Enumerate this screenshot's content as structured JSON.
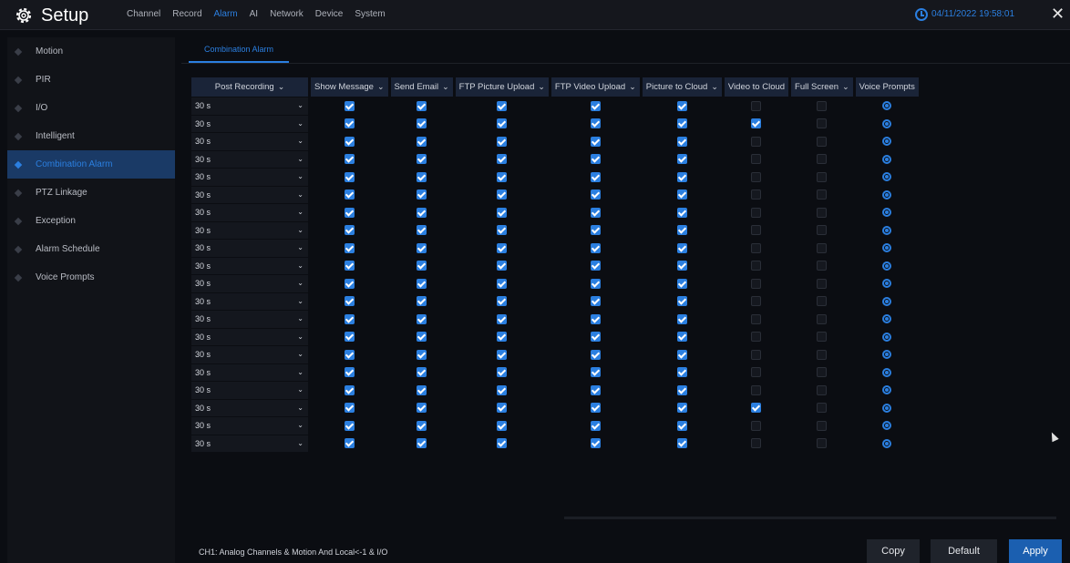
{
  "app": {
    "title": "Setup",
    "datetime": "04/11/2022 19:58:01",
    "nav": [
      "Channel",
      "Record",
      "Alarm",
      "AI",
      "Network",
      "Device",
      "System"
    ],
    "nav_active": "Alarm",
    "accent_color": "#2b7fe0"
  },
  "sidebar": {
    "items": [
      {
        "label": "Motion"
      },
      {
        "label": "PIR"
      },
      {
        "label": "I/O"
      },
      {
        "label": "Intelligent"
      },
      {
        "label": "Combination Alarm",
        "active": true
      },
      {
        "label": "PTZ Linkage"
      },
      {
        "label": "Exception"
      },
      {
        "label": "Alarm Schedule"
      },
      {
        "label": "Voice Prompts"
      }
    ]
  },
  "main": {
    "subtab": "Combination Alarm",
    "columns": [
      {
        "label": "Post Recording",
        "dropdown": true
      },
      {
        "label": "Show Message",
        "dropdown": true
      },
      {
        "label": "Send Email",
        "dropdown": true
      },
      {
        "label": "FTP Picture Upload",
        "dropdown": true
      },
      {
        "label": "FTP Video Upload",
        "dropdown": true
      },
      {
        "label": "Picture to Cloud",
        "dropdown": true
      },
      {
        "label": "Video to Cloud",
        "dropdown": false
      },
      {
        "label": "Full Screen",
        "dropdown": true
      },
      {
        "label": "Voice Prompts",
        "dropdown": false
      }
    ],
    "rows": [
      {
        "post": "30 s",
        "show": true,
        "email": true,
        "ftp_pic": true,
        "ftp_vid": true,
        "pic_cloud": true,
        "vid_cloud": false,
        "full": false
      },
      {
        "post": "30 s",
        "show": true,
        "email": true,
        "ftp_pic": true,
        "ftp_vid": true,
        "pic_cloud": true,
        "vid_cloud": true,
        "full": false
      },
      {
        "post": "30 s",
        "show": true,
        "email": true,
        "ftp_pic": true,
        "ftp_vid": true,
        "pic_cloud": true,
        "vid_cloud": false,
        "full": false
      },
      {
        "post": "30 s",
        "show": true,
        "email": true,
        "ftp_pic": true,
        "ftp_vid": true,
        "pic_cloud": true,
        "vid_cloud": false,
        "full": false
      },
      {
        "post": "30 s",
        "show": true,
        "email": true,
        "ftp_pic": true,
        "ftp_vid": true,
        "pic_cloud": true,
        "vid_cloud": false,
        "full": false
      },
      {
        "post": "30 s",
        "show": true,
        "email": true,
        "ftp_pic": true,
        "ftp_vid": true,
        "pic_cloud": true,
        "vid_cloud": false,
        "full": false
      },
      {
        "post": "30 s",
        "show": true,
        "email": true,
        "ftp_pic": true,
        "ftp_vid": true,
        "pic_cloud": true,
        "vid_cloud": false,
        "full": false
      },
      {
        "post": "30 s",
        "show": true,
        "email": true,
        "ftp_pic": true,
        "ftp_vid": true,
        "pic_cloud": true,
        "vid_cloud": false,
        "full": false
      },
      {
        "post": "30 s",
        "show": true,
        "email": true,
        "ftp_pic": true,
        "ftp_vid": true,
        "pic_cloud": true,
        "vid_cloud": false,
        "full": false
      },
      {
        "post": "30 s",
        "show": true,
        "email": true,
        "ftp_pic": true,
        "ftp_vid": true,
        "pic_cloud": true,
        "vid_cloud": false,
        "full": false
      },
      {
        "post": "30 s",
        "show": true,
        "email": true,
        "ftp_pic": true,
        "ftp_vid": true,
        "pic_cloud": true,
        "vid_cloud": false,
        "full": false
      },
      {
        "post": "30 s",
        "show": true,
        "email": true,
        "ftp_pic": true,
        "ftp_vid": true,
        "pic_cloud": true,
        "vid_cloud": false,
        "full": false
      },
      {
        "post": "30 s",
        "show": true,
        "email": true,
        "ftp_pic": true,
        "ftp_vid": true,
        "pic_cloud": true,
        "vid_cloud": false,
        "full": false
      },
      {
        "post": "30 s",
        "show": true,
        "email": true,
        "ftp_pic": true,
        "ftp_vid": true,
        "pic_cloud": true,
        "vid_cloud": false,
        "full": false
      },
      {
        "post": "30 s",
        "show": true,
        "email": true,
        "ftp_pic": true,
        "ftp_vid": true,
        "pic_cloud": true,
        "vid_cloud": false,
        "full": false
      },
      {
        "post": "30 s",
        "show": true,
        "email": true,
        "ftp_pic": true,
        "ftp_vid": true,
        "pic_cloud": true,
        "vid_cloud": false,
        "full": false
      },
      {
        "post": "30 s",
        "show": true,
        "email": true,
        "ftp_pic": true,
        "ftp_vid": true,
        "pic_cloud": true,
        "vid_cloud": false,
        "full": false
      },
      {
        "post": "30 s",
        "show": true,
        "email": true,
        "ftp_pic": true,
        "ftp_vid": true,
        "pic_cloud": true,
        "vid_cloud": true,
        "full": false
      },
      {
        "post": "30 s",
        "show": true,
        "email": true,
        "ftp_pic": true,
        "ftp_vid": true,
        "pic_cloud": true,
        "vid_cloud": false,
        "full": false
      },
      {
        "post": "30 s",
        "show": true,
        "email": true,
        "ftp_pic": true,
        "ftp_vid": true,
        "pic_cloud": true,
        "vid_cloud": false,
        "full": false
      }
    ],
    "footer_text": "CH1: Analog Channels & Motion And Local<-1 & I/O",
    "buttons": {
      "copy": "Copy",
      "default": "Default",
      "apply": "Apply"
    }
  }
}
